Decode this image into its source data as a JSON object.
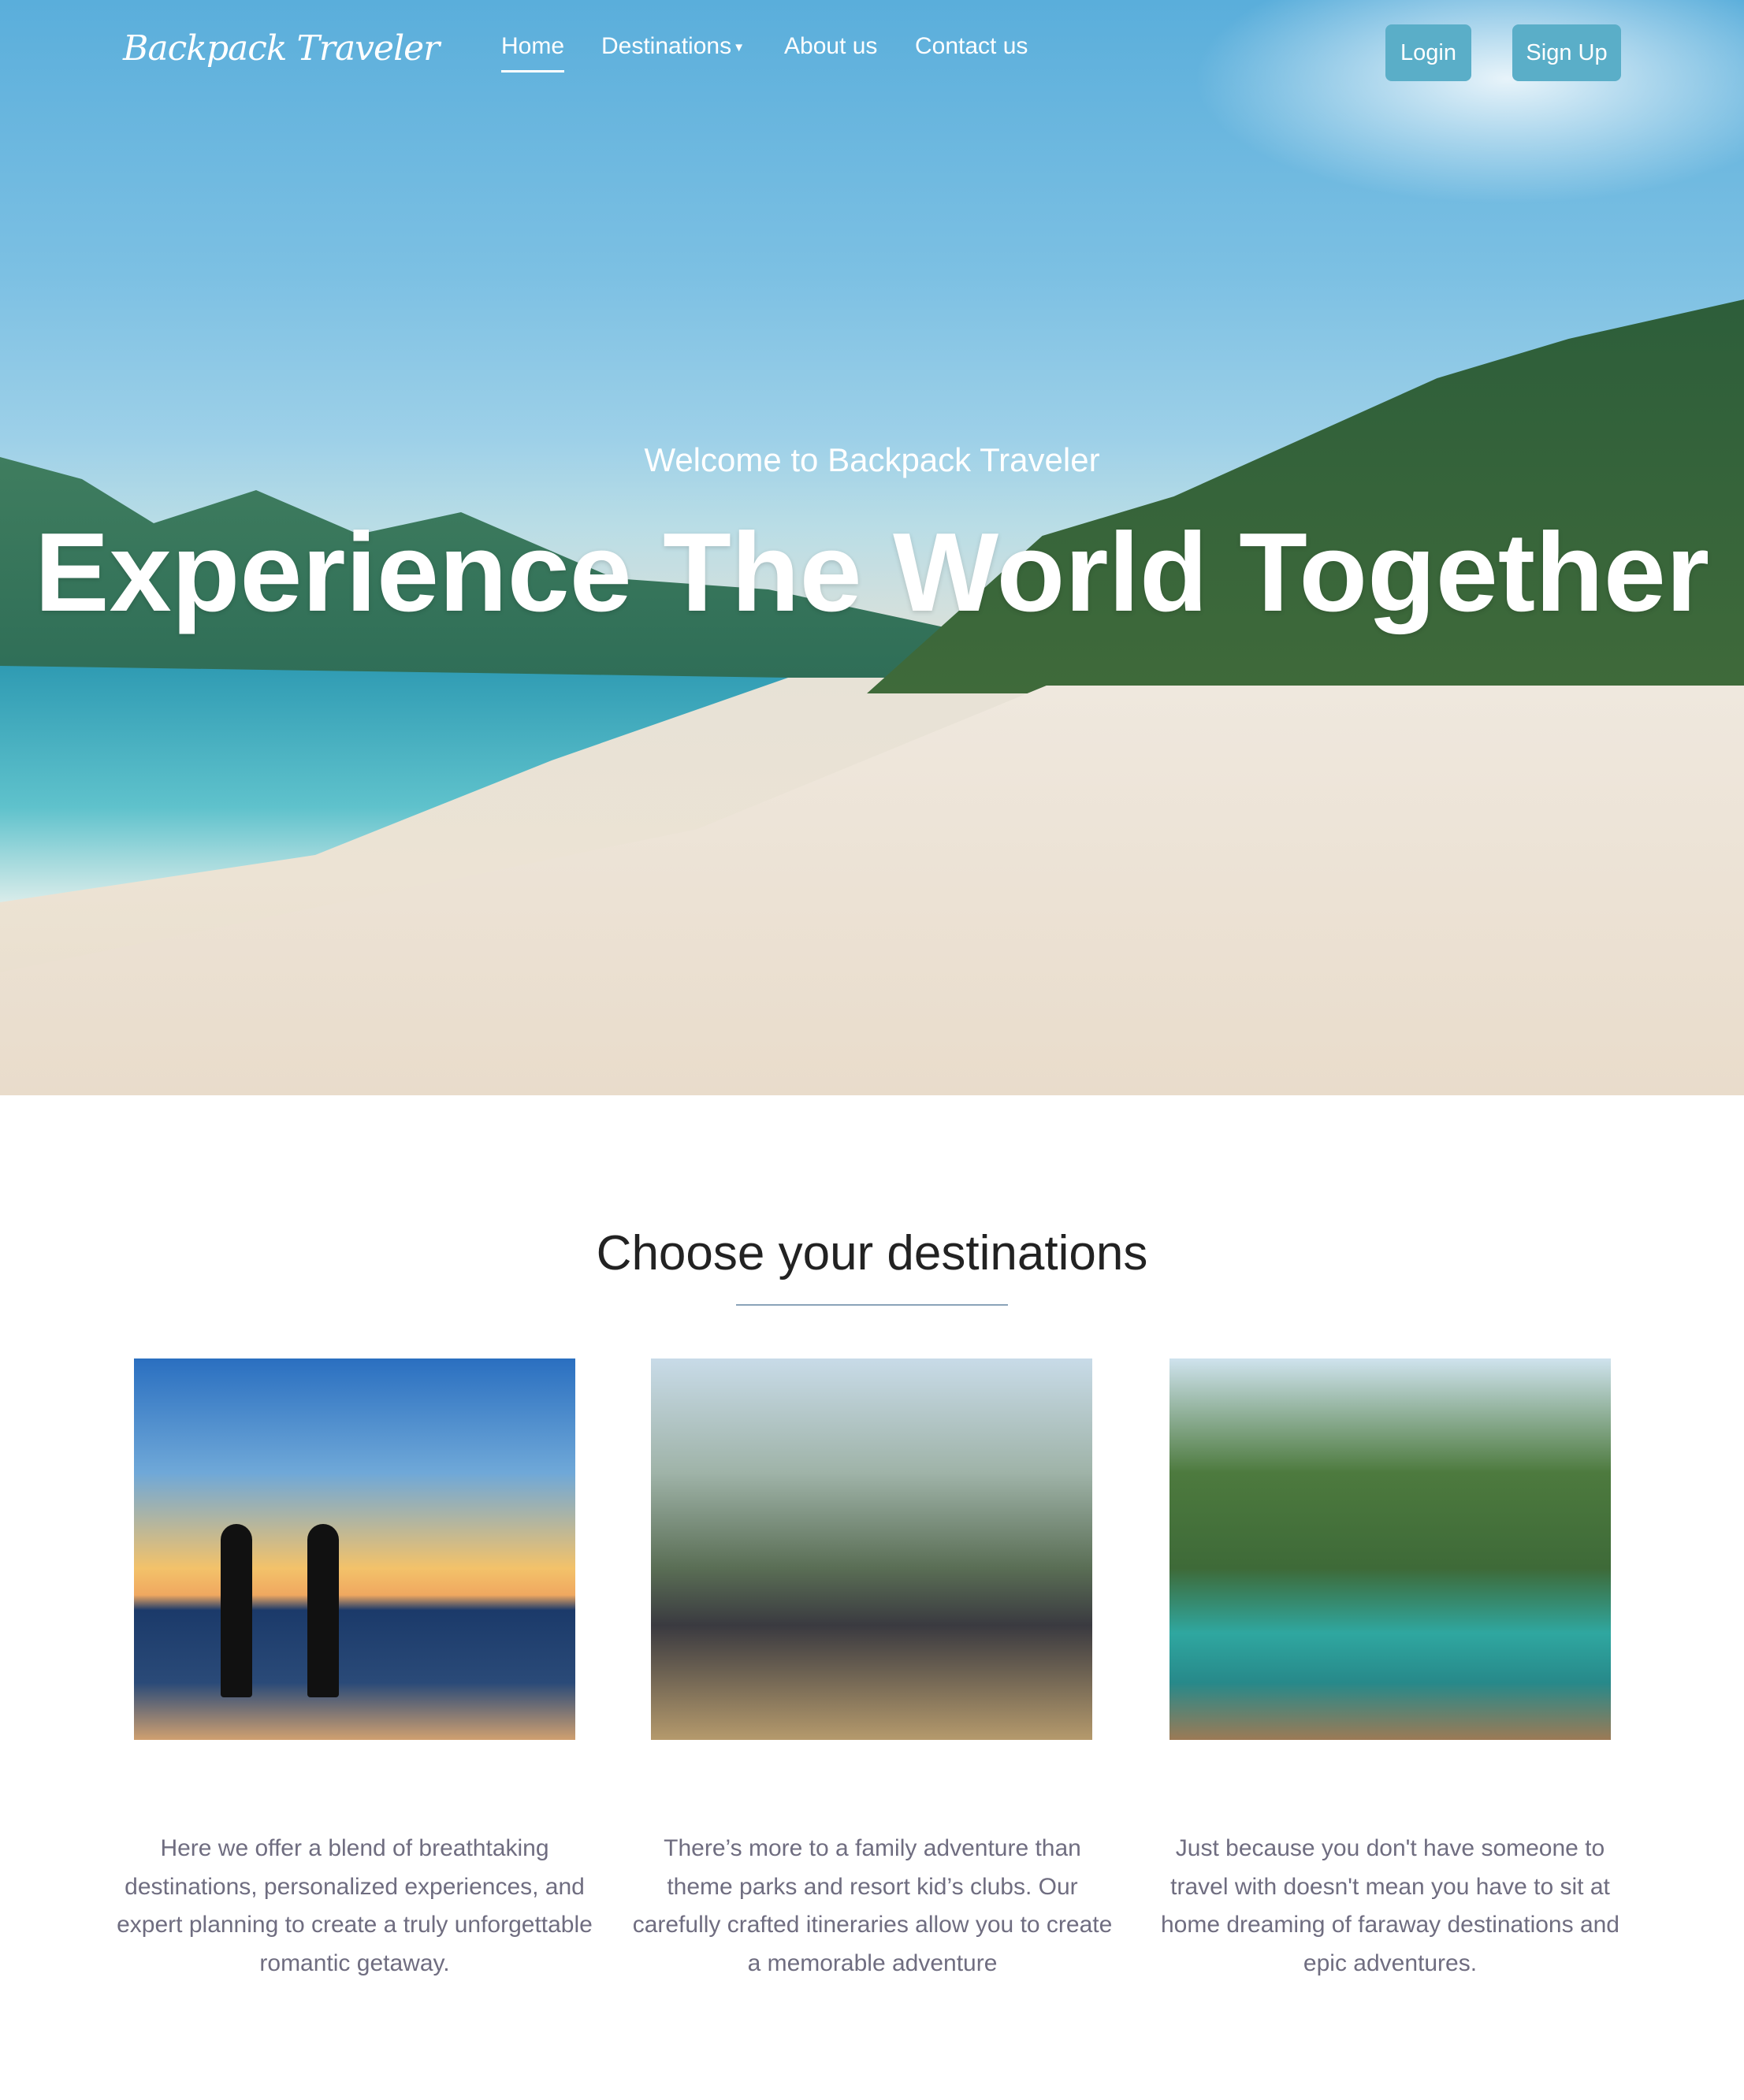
{
  "nav": {
    "logo": "Backpack Traveler",
    "links": [
      {
        "label": "Home"
      },
      {
        "label": "Destinations"
      },
      {
        "label": "About us"
      },
      {
        "label": "Contact us"
      }
    ],
    "dropdown_icon": "chevron-down-icon",
    "login": "Login",
    "signup": "Sign Up"
  },
  "hero": {
    "welcome": "Welcome to Backpack Traveler",
    "title": "Experience The World Together"
  },
  "section": {
    "heading": "Choose your destinations",
    "cards": [
      {
        "image": "couple-sunset-beach",
        "text": "Here we offer a blend of breathtaking destinations, personalized experiences, and expert planning to create a truly unforgettable romantic getaway."
      },
      {
        "image": "family-cyclists-mountains",
        "text": "There’s more to a family adventure than theme parks and resort kid’s clubs. Our carefully crafted itineraries allow you to create a memorable adventure"
      },
      {
        "image": "woman-boat-lagoon",
        "text": "Just because you don't have someone to travel with doesn't mean you have to sit at home dreaming of faraway destinations and epic adventures."
      }
    ]
  },
  "colors": {
    "accent": "#5aaec8",
    "text": "#6f6d80"
  }
}
